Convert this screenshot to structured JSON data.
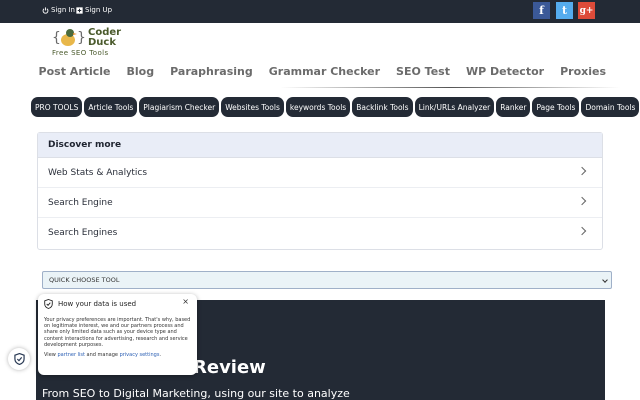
{
  "header": {
    "signin_label": "Sign In",
    "signup_label": "Sign Up",
    "social": [
      {
        "name": "facebook",
        "glyph": "f",
        "color": "#3b5998"
      },
      {
        "name": "twitter",
        "glyph": "t",
        "color": "#55acee"
      },
      {
        "name": "google-plus",
        "glyph": "g+",
        "color": "#dd4b39"
      }
    ]
  },
  "logo": {
    "line1": "Coder",
    "line2": "Duck",
    "tagline": "Free SEO Tools"
  },
  "nav": {
    "items": [
      "Post Article",
      "Blog",
      "Paraphrasing",
      "Grammar Checker",
      "SEO Test",
      "WP Detector",
      "Proxies"
    ]
  },
  "tools": {
    "items": [
      "PRO TOOLS",
      "Article Tools",
      "Plagiarism Checker",
      "Websites Tools",
      "keywords Tools",
      "Backlink Tools",
      "Link/URLs Analyzer",
      "Ranker",
      "Page Tools",
      "Domain Tools"
    ]
  },
  "discover": {
    "title": "Discover more",
    "items": [
      "Web Stats & Analytics",
      "Search Engine",
      "Search Engines"
    ]
  },
  "select": {
    "value": "QUICK CHOOSE TOOL"
  },
  "hero": {
    "title_partial": "Review",
    "subtitle": "From SEO to Digital Marketing, using our site to analyze"
  },
  "privacy": {
    "title": "How your data is used",
    "close": "×",
    "body": "Your privacy preferences are important. That's why, based on legitimate interest, we and our partners process and share only limited data such as your device type and content interactions for advertising, research and service development purposes.",
    "foot_prefix": "View ",
    "partner_link": "partner list",
    "foot_mid": " and manage ",
    "settings_link": "privacy settings",
    "foot_suffix": "."
  },
  "colors": {
    "dark": "#232a35",
    "discover_header": "#e9edf7",
    "link": "#2b5fb4"
  }
}
